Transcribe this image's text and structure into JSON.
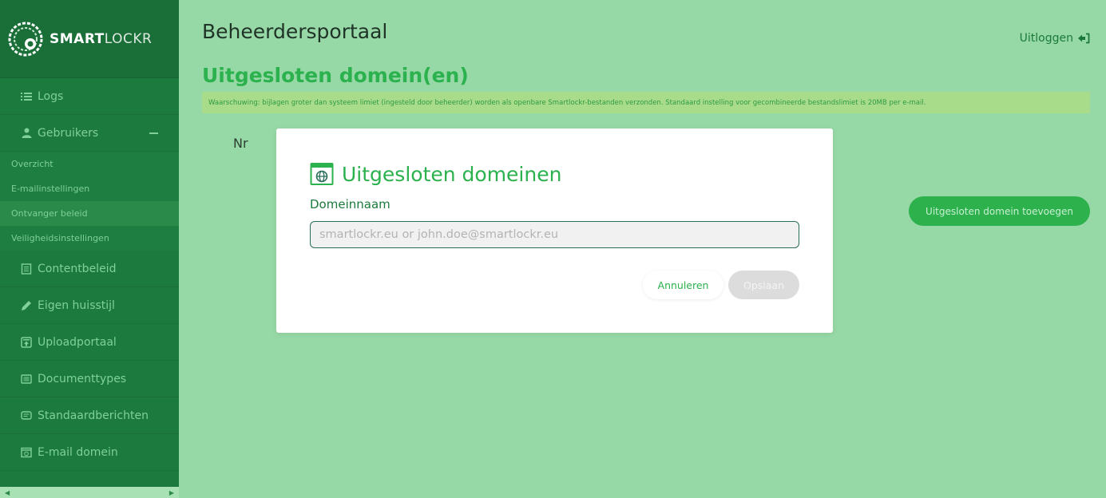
{
  "brand": {
    "name_bold": "SMART",
    "name_light": "LOCKR"
  },
  "sidebar": {
    "items": [
      {
        "label": "Logs",
        "icon": "list-icon"
      },
      {
        "label": "Gebruikers",
        "icon": "user-icon",
        "expanded": true
      },
      {
        "label": "Contentbeleid",
        "icon": "document-icon"
      },
      {
        "label": "Eigen huisstijl",
        "icon": "pencil-icon"
      },
      {
        "label": "Uploadportaal",
        "icon": "upload-icon"
      },
      {
        "label": "Documenttypes",
        "icon": "file-list-icon"
      },
      {
        "label": "Standaardberichten",
        "icon": "message-icon"
      },
      {
        "label": "E-mail domein",
        "icon": "mail-domain-icon"
      }
    ],
    "subitems": [
      {
        "label": "Overzicht"
      },
      {
        "label": "E-mailinstellingen"
      },
      {
        "label": "Ontvanger beleid",
        "active": true
      },
      {
        "label": "Veiligheidsinstellingen"
      }
    ]
  },
  "header": {
    "title": "Beheerdersportaal",
    "logout_label": "Uitloggen"
  },
  "main": {
    "page_title": "Uitgesloten domein(en)",
    "warning": "Waarschuwing: bijlagen groter dan systeem limiet (ingesteld door beheerder) worden als openbare Smartlockr-bestanden verzonden. Standaard instelling voor gecombineerde bestandslimiet is 20MB per e-mail.",
    "column_nr": "Nr",
    "add_button": "Uitgesloten domein toevoegen"
  },
  "modal": {
    "title": "Uitgesloten domeinen",
    "field_label": "Domeinnaam",
    "field_value": "",
    "field_placeholder": "smartlockr.eu or john.doe@smartlockr.eu",
    "cancel_label": "Annuleren",
    "save_label": "Opslaan"
  },
  "colors": {
    "accent": "#2bb14d",
    "sidebar": "#1d7a3e",
    "background": "#97d9a6"
  }
}
